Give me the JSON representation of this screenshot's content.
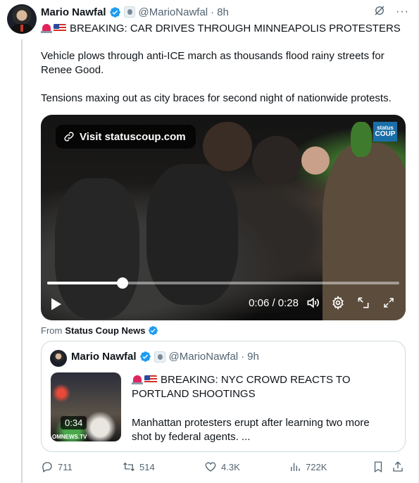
{
  "post": {
    "author_name": "Mario Nawfal",
    "handle": "@MarioNawfal",
    "separator": "·",
    "time": "8h",
    "more_label": "···",
    "headline": "BREAKING: CAR DRIVES THROUGH MINNEAPOLIS PROTESTERS",
    "paragraph1": "Vehicle plows through anti-ICE march as thousands flood rainy streets for Renee Good.",
    "paragraph2": "Tensions maxing out as city braces for second night of nationwide protests."
  },
  "video": {
    "visit_link": "Visit statuscoup.com",
    "logo_line1": "status",
    "logo_line2": "COUP",
    "time_display": "0:06 / 0:28",
    "progress_fraction": 0.214
  },
  "source": {
    "prefix": "From",
    "name": "Status Coup News"
  },
  "quote": {
    "author_name": "Mario Nawfal",
    "handle": "@MarioNawfal",
    "separator": "·",
    "time": "9h",
    "headline": "BREAKING: NYC CROWD REACTS TO PORTLAND SHOOTINGS",
    "body": "Manhattan protesters erupt after learning two more shot by federal agents. ...",
    "duration": "0:34",
    "watermark": "OMNEWS.TV"
  },
  "actions": {
    "replies": "711",
    "reposts": "514",
    "likes": "4.3K",
    "views": "722K"
  },
  "colors": {
    "verified": "#1d9bf0",
    "muted": "#536471",
    "border": "#cfd9de"
  }
}
